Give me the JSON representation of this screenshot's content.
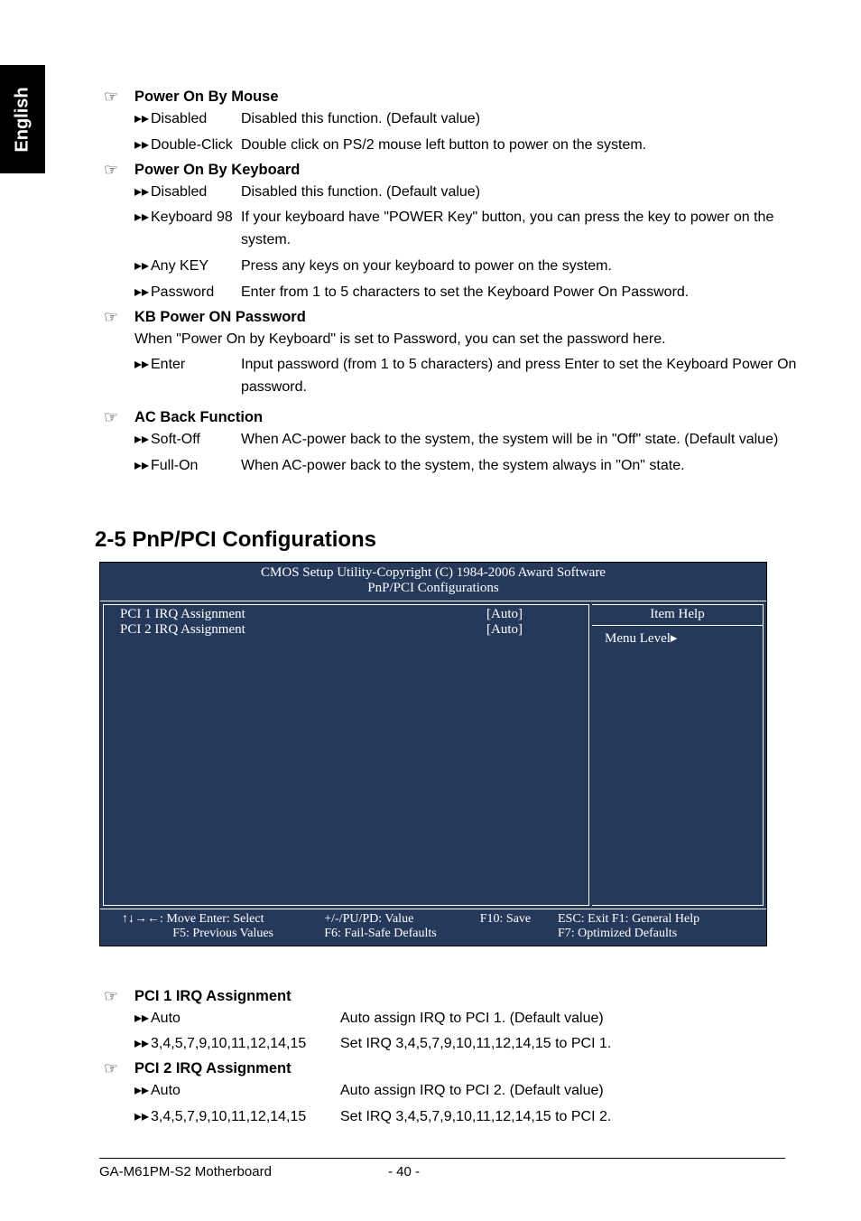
{
  "sideTab": "English",
  "sections": {
    "powerMouse": {
      "title": "Power On By Mouse",
      "opts": [
        {
          "label": "Disabled",
          "desc": "Disabled this function. (Default value)"
        },
        {
          "label": "Double-Click",
          "desc": "Double click on PS/2 mouse left button to power on the system."
        }
      ]
    },
    "powerKeyboard": {
      "title": "Power On By Keyboard",
      "opts": [
        {
          "label": "Disabled",
          "desc": "Disabled this function. (Default value)"
        },
        {
          "label": "Keyboard 98",
          "desc": "If your keyboard have \"POWER Key\" button, you can press the key to power on the system."
        },
        {
          "label": "Any KEY",
          "desc": "Press any keys on your keyboard to power on the system."
        },
        {
          "label": "Password",
          "desc": "Enter from 1 to 5 characters to set the Keyboard Power On Password."
        }
      ]
    },
    "kbPassword": {
      "title": "KB Power ON Password",
      "note": "When \"Power On by Keyboard\" is set to Password, you can set the password here.",
      "opts": [
        {
          "label": "Enter",
          "desc": "Input password (from 1 to 5 characters) and press Enter to set the Keyboard Power On password."
        }
      ]
    },
    "acBack": {
      "title": "AC Back Function",
      "opts": [
        {
          "label": "Soft-Off",
          "desc": "When AC-power back to the system, the system will be in \"Off\" state. (Default value)"
        },
        {
          "label": "Full-On",
          "desc": "When AC-power back to the system, the system always in \"On\" state."
        }
      ]
    }
  },
  "heading25": "2-5     PnP/PCI Configurations",
  "bios": {
    "header1": "CMOS Setup Utility-Copyright (C) 1984-2006 Award Software",
    "header2": "PnP/PCI Configurations",
    "rows": [
      {
        "label": "PCI 1 IRQ Assignment",
        "value": "[Auto]"
      },
      {
        "label": "PCI 2 IRQ Assignment",
        "value": "[Auto]"
      }
    ],
    "help": {
      "title": "Item Help",
      "menu": "Menu Level▸"
    },
    "footer": {
      "c1a": "↑↓→←: Move      Enter: Select",
      "c1b": "F5: Previous Values",
      "c2a": "+/-/PU/PD: Value",
      "c2b": "F6: Fail-Safe Defaults",
      "c3a": "F10: Save",
      "c4a": "ESC: Exit        F1: General Help",
      "c4b": "F7: Optimized Defaults"
    }
  },
  "lower": {
    "pci1": {
      "title": "PCI 1 IRQ Assignment",
      "opts": [
        {
          "label": "Auto",
          "desc": "Auto assign IRQ to PCI 1. (Default value)"
        },
        {
          "label": "3,4,5,7,9,10,11,12,14,15",
          "desc": "Set IRQ 3,4,5,7,9,10,11,12,14,15 to PCI 1."
        }
      ]
    },
    "pci2": {
      "title": "PCI 2 IRQ Assignment",
      "opts": [
        {
          "label": "Auto",
          "desc": "Auto assign IRQ to PCI 2. (Default value)"
        },
        {
          "label": "3,4,5,7,9,10,11,12,14,15",
          "desc": "Set IRQ 3,4,5,7,9,10,11,12,14,15 to PCI 2."
        }
      ]
    }
  },
  "footer": {
    "left": "GA-M61PM-S2 Motherboard",
    "center": "- 40 -"
  },
  "glyphs": {
    "hand": "☞",
    "arrow": "▸▸"
  }
}
